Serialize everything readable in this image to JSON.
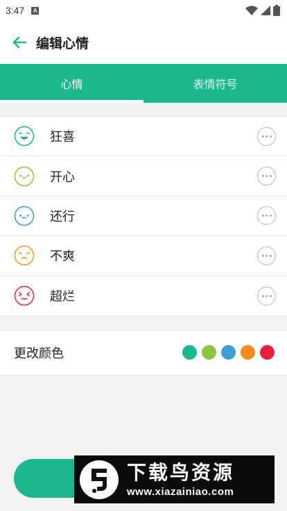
{
  "status_bar": {
    "time": "3:47",
    "notification": "A"
  },
  "app_bar": {
    "title": "编辑心情"
  },
  "tabs": [
    {
      "label": "心情",
      "active": true
    },
    {
      "label": "表情符号",
      "active": false
    }
  ],
  "moods": [
    {
      "label": "狂喜",
      "color": "#1db88e",
      "face": "ecstatic"
    },
    {
      "label": "开心",
      "color": "#8cc63f",
      "face": "happy"
    },
    {
      "label": "还行",
      "color": "#3e9fd6",
      "face": "okay"
    },
    {
      "label": "不爽",
      "color": "#f39c1f",
      "face": "upset"
    },
    {
      "label": "超烂",
      "color": "#e8283a",
      "face": "awful"
    }
  ],
  "color_section": {
    "label": "更改颜色",
    "swatches": [
      "#1db88e",
      "#8cc63f",
      "#3e9fd6",
      "#f38a1f",
      "#e8203a"
    ]
  },
  "colors": {
    "accent": "#1db88e"
  },
  "watermark": {
    "title": "下载鸟资源",
    "url": "www.xiazainiao.com"
  }
}
